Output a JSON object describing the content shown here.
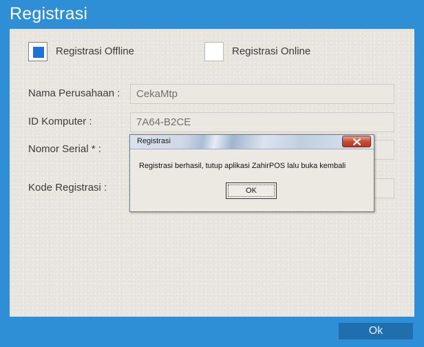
{
  "window": {
    "title": "Registrasi"
  },
  "mode": {
    "offline_label": "Registrasi Offline",
    "online_label": "Registrasi Online",
    "selected": "offline"
  },
  "form": {
    "company_label": "Nama Perusahaan :",
    "company_value": "CekaMtp",
    "computer_id_label": "ID Komputer :",
    "computer_id_value": "7A64-B2CE",
    "serial_label": "Nomor Serial * :",
    "serial_value": "",
    "reg_code_label": "Kode Registrasi :",
    "reg_code_value": ""
  },
  "footer": {
    "ok_label": "Ok"
  },
  "dialog": {
    "title": "Registrasi",
    "message": "Registrasi berhasil, tutup aplikasi ZahirPOS lalu buka kembali",
    "ok_label": "OK"
  },
  "colors": {
    "accent": "#2f8fd6",
    "selected_box": "#1e73d8",
    "close_button": "#c64d35"
  }
}
